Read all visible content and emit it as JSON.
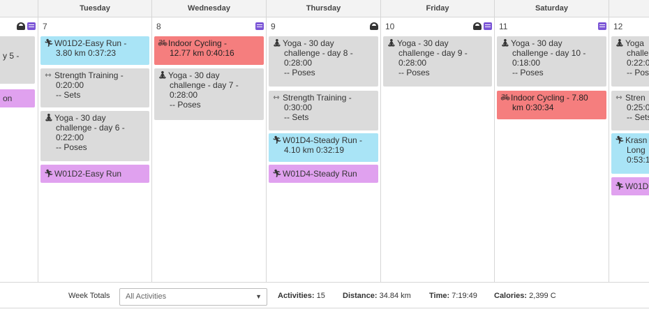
{
  "days": [
    {
      "name": "",
      "num": ""
    },
    {
      "name": "Tuesday",
      "num": "7"
    },
    {
      "name": "Wednesday",
      "num": "8"
    },
    {
      "name": "Thursday",
      "num": "9"
    },
    {
      "name": "Friday",
      "num": "10"
    },
    {
      "name": "Saturday",
      "num": "11"
    },
    {
      "name": "",
      "num": "12"
    }
  ],
  "events": {
    "mon": [
      {
        "line1": "y 5 -",
        "icon": "yoga-icon"
      },
      {
        "line1": "on",
        "icon": "run-icon"
      }
    ],
    "tue": [
      {
        "line1": "W01D2-Easy Run -",
        "line2": "3.80 km 0:37:23",
        "icon": "run-icon",
        "color": "blue"
      },
      {
        "line1": "Strength Training -",
        "line2": "0:20:00",
        "line3": "-- Sets",
        "icon": "dumbbell-icon",
        "color": "gray"
      },
      {
        "line1": "Yoga - 30 day",
        "line2": "challenge - day 6 -",
        "line3": "0:22:00",
        "line4": "-- Poses",
        "icon": "yoga-icon",
        "color": "gray"
      },
      {
        "line1": "W01D2-Easy Run",
        "icon": "run-icon",
        "color": "purple"
      }
    ],
    "wed": [
      {
        "line1": "Indoor Cycling -",
        "line2": "12.77 km 0:40:16",
        "icon": "bike-icon",
        "color": "red"
      },
      {
        "line1": "Yoga - 30 day",
        "line2": "challenge - day 7 -",
        "line3": "0:28:00",
        "line4": "-- Poses",
        "icon": "yoga-icon",
        "color": "gray"
      }
    ],
    "thu": [
      {
        "line1": "Yoga - 30 day",
        "line2": "challenge - day 8 -",
        "line3": "0:28:00",
        "line4": "-- Poses",
        "icon": "yoga-icon",
        "color": "gray"
      },
      {
        "line1": "Strength Training -",
        "line2": "0:30:00",
        "line3": "-- Sets",
        "icon": "dumbbell-icon",
        "color": "gray"
      },
      {
        "line1": "W01D4-Steady Run -",
        "line2": "4.10 km 0:32:19",
        "icon": "run-icon",
        "color": "blue"
      },
      {
        "line1": "W01D4-Steady Run",
        "icon": "run-icon",
        "color": "purple"
      }
    ],
    "fri": [
      {
        "line1": "Yoga - 30 day",
        "line2": "challenge - day 9 -",
        "line3": "0:28:00",
        "line4": "-- Poses",
        "icon": "yoga-icon",
        "color": "gray"
      }
    ],
    "sat": [
      {
        "line1": "Yoga - 30 day",
        "line2": "challenge - day 10 -",
        "line3": "0:18:00",
        "line4": "-- Poses",
        "icon": "yoga-icon",
        "color": "gray"
      },
      {
        "line1": "Indoor Cycling - 7.80",
        "line2": "km 0:30:34",
        "icon": "bike-icon",
        "color": "red"
      }
    ],
    "sun": [
      {
        "line1": "Yoga",
        "line2": "challe",
        "line3": "0:22:0",
        "line4": "-- Pos",
        "icon": "yoga-icon",
        "color": "gray"
      },
      {
        "line1": "Stren",
        "line2": "0:25:0",
        "line3": "-- Sets",
        "icon": "dumbbell-icon",
        "color": "gray"
      },
      {
        "line1": "Krasn",
        "line2": "Long",
        "line3": "0:53:1",
        "icon": "run-icon",
        "color": "blue"
      },
      {
        "line1": "W01D",
        "icon": "run-icon",
        "color": "purple"
      }
    ]
  },
  "footer": {
    "label": "Week Totals",
    "select_value": "All Activities",
    "activities_label": "Activities:",
    "activities_value": "15",
    "distance_label": "Distance:",
    "distance_value": "34.84 km",
    "time_label": "Time:",
    "time_value": "7:19:49",
    "calories_label": "Calories:",
    "calories_value": "2,399 C"
  },
  "colors": {
    "blue": "#a9e4f6",
    "gray": "#dbdbdb",
    "red": "#f57e7e",
    "purple": "#e0a1ef",
    "note_icon": "#7b55d6"
  }
}
